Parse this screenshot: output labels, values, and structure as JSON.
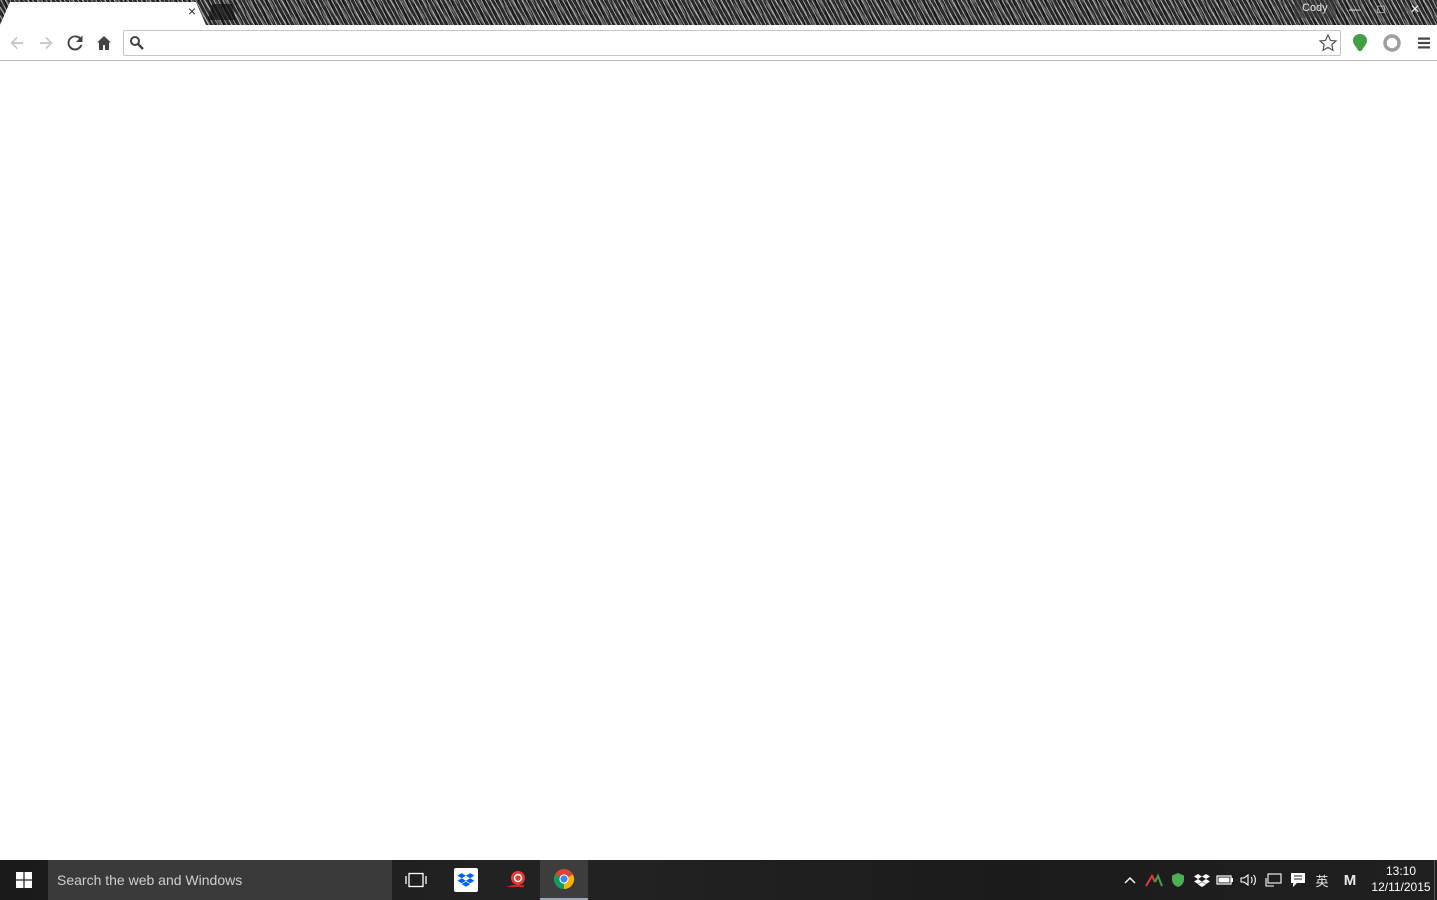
{
  "browser": {
    "tab": {
      "title": "",
      "close_label": "×"
    },
    "profile_name": "Cody",
    "window_controls": {
      "minimize": "—",
      "maximize": "□",
      "close": "✕"
    },
    "toolbar": {
      "back_icon": "back-arrow-icon",
      "forward_icon": "forward-arrow-icon",
      "reload_icon": "reload-icon",
      "home_icon": "home-icon",
      "extensions": [
        "evernote-extension-icon",
        "gray-circle-extension-icon"
      ],
      "menu_icon": "hamburger-menu-icon"
    },
    "omnibox": {
      "value": "",
      "placeholder": ""
    }
  },
  "taskbar": {
    "search_placeholder": "Search the web and Windows",
    "pinned": [
      {
        "name": "task-view",
        "icon": "task-view-icon"
      },
      {
        "name": "dropbox",
        "icon": "dropbox-icon"
      },
      {
        "name": "snail",
        "icon": "snail-app-icon"
      },
      {
        "name": "chrome",
        "icon": "chrome-icon",
        "active": true
      }
    ],
    "tray": {
      "ime_label": "英",
      "m_label": "M"
    },
    "clock": {
      "time": "13:10",
      "date": "12/11/2015"
    }
  },
  "colors": {
    "accent_green": "#4caf50",
    "taskbar_bg": "#1c1c1c",
    "search_bg": "#3a3a3a"
  }
}
